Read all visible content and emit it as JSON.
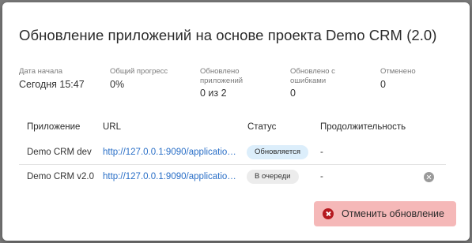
{
  "dialog": {
    "title": "Обновление приложений на основе проекта Demo CRM (2.0)"
  },
  "stats": [
    {
      "label": "Дата начала",
      "value": "Сегодня 15:47"
    },
    {
      "label": "Общий прогресс",
      "value": "0%"
    },
    {
      "label": "Обновлено приложений",
      "value": "0 из 2"
    },
    {
      "label": "Обновлено с ошибками",
      "value": "0"
    },
    {
      "label": "Отменено",
      "value": "0"
    }
  ],
  "table": {
    "columns": {
      "app": "Приложение",
      "url": "URL",
      "status": "Статус",
      "duration": "Продолжительность"
    },
    "rows": [
      {
        "app": "Demo CRM dev",
        "url": "http://127.0.0.1:9090/applications/",
        "status": "Обновляется",
        "duration": "-"
      },
      {
        "app": "Demo CRM v2.0",
        "url": "http://127.0.0.1:9090/applications/",
        "status": "В очереди",
        "duration": "-"
      }
    ]
  },
  "actions": {
    "cancel_label": "Отменить обновление"
  },
  "colors": {
    "link": "#2a6fc7",
    "updating_badge": "#dceefb",
    "queued_badge": "#ececec",
    "cancel_button_bg": "#f5b8b8",
    "cancel_icon": "#b5191f"
  },
  "icons": {
    "remove_row": "remove-circle-icon",
    "cancel": "cancel-circle-icon"
  }
}
